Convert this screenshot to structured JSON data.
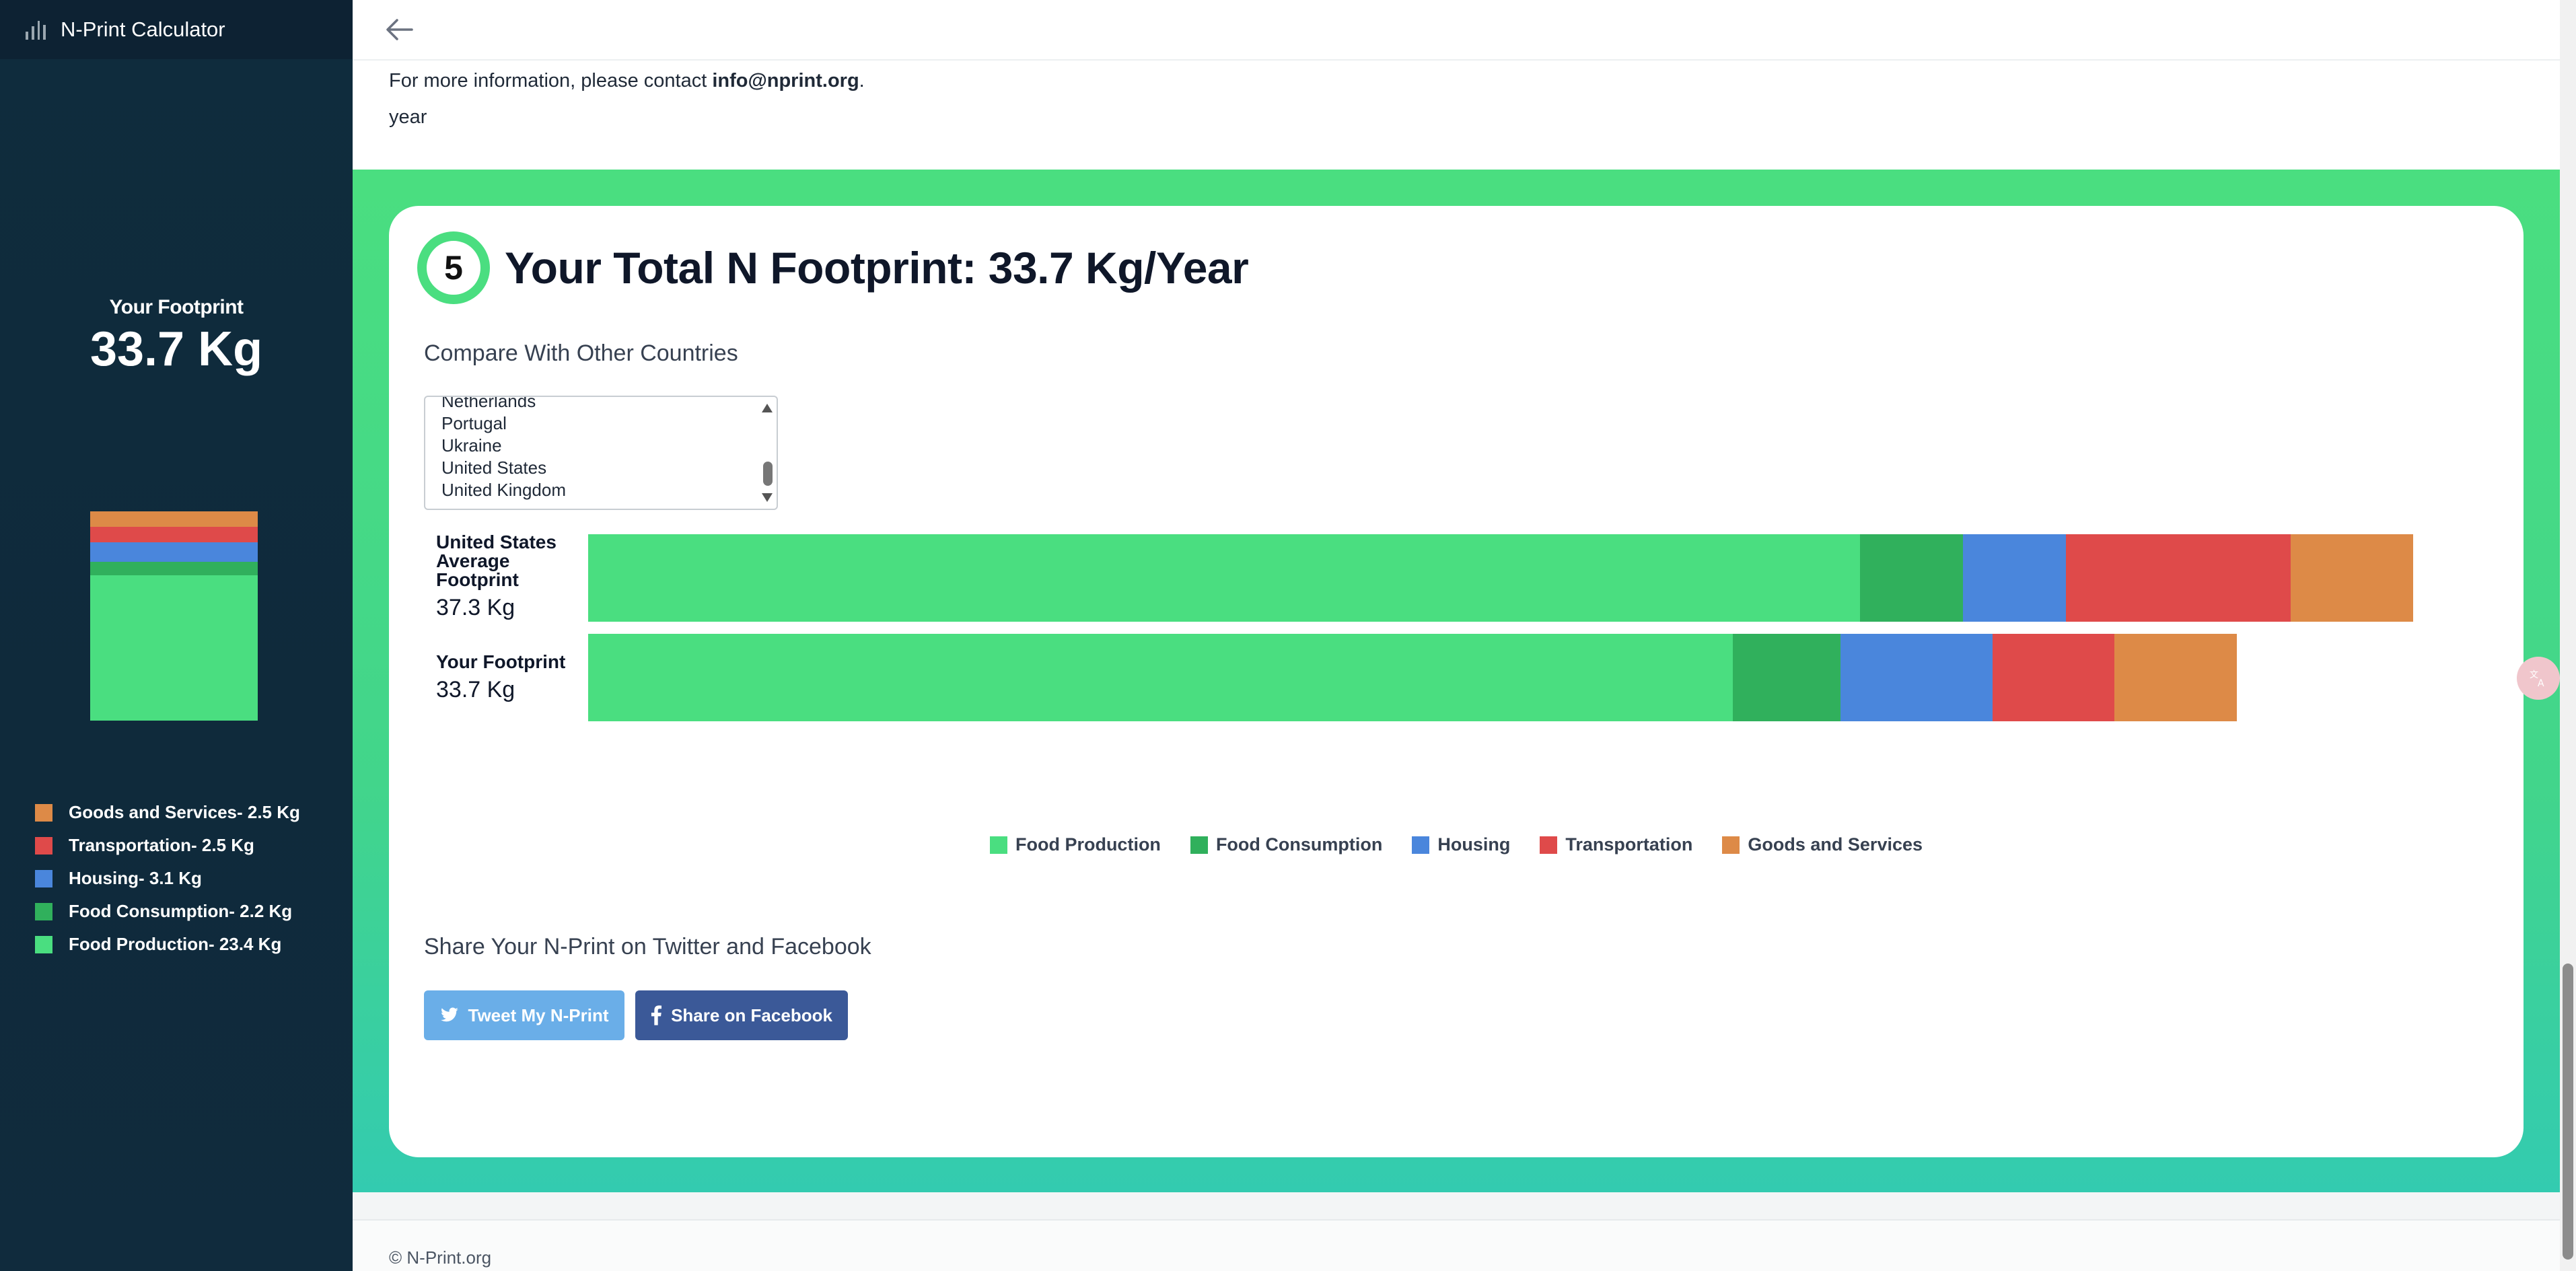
{
  "app": {
    "title": "N-Print Calculator"
  },
  "sidebar": {
    "footprint_label": "Your Footprint",
    "footprint_value": "33.7 Kg",
    "legend": [
      {
        "label": "Goods and Services- 2.5 Kg",
        "color": "#dd8a47"
      },
      {
        "label": "Transportation- 2.5 Kg",
        "color": "#df4a4a"
      },
      {
        "label": "Housing- 3.1 Kg",
        "color": "#4a86dc"
      },
      {
        "label": "Food Consumption- 2.2 Kg",
        "color": "#30b05c"
      },
      {
        "label": "Food Production- 23.4 Kg",
        "color": "#4ade80"
      }
    ]
  },
  "info": {
    "prefix": "For more information, please contact ",
    "email": "info@nprint.org",
    "suffix": ".",
    "year_label": "year"
  },
  "result": {
    "step": "5",
    "title": "Your Total N Footprint: 33.7 Kg/Year",
    "compare_label": "Compare With Other Countries",
    "countries": [
      "Netherlands",
      "Portugal",
      "Ukraine",
      "United States",
      "United Kingdom"
    ]
  },
  "chart_data": {
    "type": "bar",
    "orientation": "horizontal",
    "stacked": true,
    "categories": [
      "United States Average Footprint",
      "Your Footprint"
    ],
    "values_label": [
      "37.3 Kg",
      "33.7 Kg"
    ],
    "series": [
      {
        "name": "Food Production",
        "values": [
          26.0,
          23.4
        ]
      },
      {
        "name": "Food Consumption",
        "values": [
          2.1,
          2.2
        ]
      },
      {
        "name": "Housing",
        "values": [
          2.1,
          3.1
        ]
      },
      {
        "name": "Transportation",
        "values": [
          4.6,
          2.5
        ]
      },
      {
        "name": "Goods and Services",
        "values": [
          2.5,
          2.5
        ]
      }
    ],
    "colors": [
      "#4ade80",
      "#30b05c",
      "#4a86dc",
      "#df4a4a",
      "#dd8a47"
    ],
    "legend_position": "bottom"
  },
  "share": {
    "title": "Share Your N-Print on Twitter and Facebook",
    "tweet_label": "Tweet My N-Print",
    "facebook_label": "Share on Facebook"
  },
  "footer": {
    "copyright": "© N-Print.org"
  }
}
